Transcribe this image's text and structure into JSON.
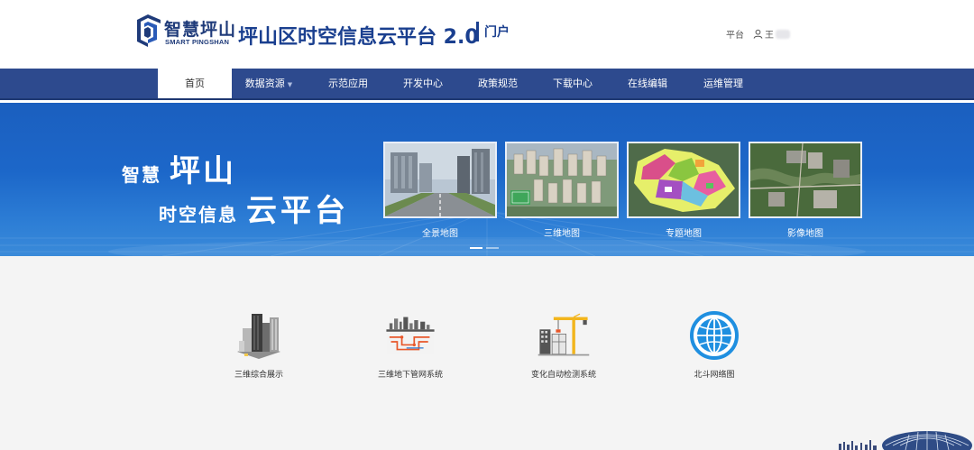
{
  "header": {
    "logo_cn": "智慧坪山",
    "logo_en": "SMART PINGSHAN",
    "title": "坪山区时空信息云平台 2.0",
    "subtitle": "门户",
    "platform_link": "平台",
    "user_name": "王"
  },
  "nav": {
    "items": [
      {
        "label": "首页",
        "active": true
      },
      {
        "label": "数据资源",
        "dropdown": true
      },
      {
        "label": "示范应用"
      },
      {
        "label": "开发中心"
      },
      {
        "label": "政策规范"
      },
      {
        "label": "下载中心"
      },
      {
        "label": "在线编辑"
      },
      {
        "label": "运维管理"
      }
    ]
  },
  "banner": {
    "line1_small": "智慧",
    "line1_big": "坪山",
    "line2_small": "时空信息",
    "line2_big": "云平台",
    "maps": [
      {
        "label": "全景地图",
        "icon": "street-view-photo"
      },
      {
        "label": "三维地图",
        "icon": "3d-city-photo"
      },
      {
        "label": "专题地图",
        "icon": "thematic-map-image"
      },
      {
        "label": "影像地图",
        "icon": "satellite-image"
      }
    ],
    "carousel_pages": 2,
    "carousel_active": 1
  },
  "apps": [
    {
      "label": "三维综合展示",
      "icon": "3d-buildings-icon"
    },
    {
      "label": "三维地下管网系统",
      "icon": "underground-pipeline-icon"
    },
    {
      "label": "变化自动检测系统",
      "icon": "construction-crane-icon"
    },
    {
      "label": "北斗网络图",
      "icon": "globe-icon"
    }
  ],
  "colors": {
    "brand_blue": "#1a3f8f",
    "nav_bg": "#2d4a8e",
    "banner_blue": "#1c67c9",
    "main_bg": "#f4f4f4"
  }
}
